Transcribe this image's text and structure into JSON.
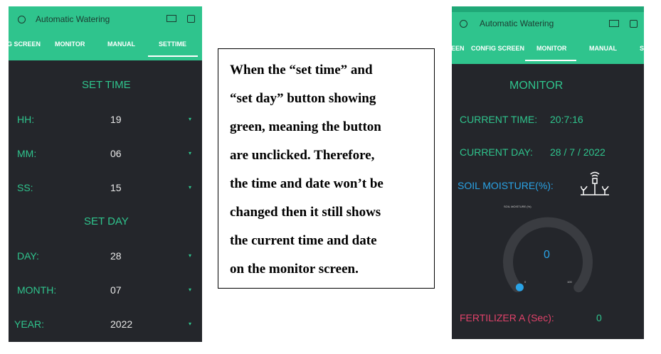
{
  "left_phone": {
    "app_title": "Automatic Watering",
    "tabs": [
      "G SCREEN",
      "MONITOR",
      "MANUAL",
      "SETTIME"
    ],
    "active_tab": "SETTIME",
    "set_time_heading": "SET TIME",
    "time_fields": [
      {
        "label": "HH:",
        "value": "19"
      },
      {
        "label": "MM:",
        "value": "06"
      },
      {
        "label": "SS:",
        "value": "15"
      }
    ],
    "set_day_heading": "SET DAY",
    "day_fields": [
      {
        "label": "DAY:",
        "value": "28"
      },
      {
        "label": "MONTH:",
        "value": "07"
      },
      {
        "label": "YEAR:",
        "value": "2022"
      }
    ],
    "dropdown_glyph": "▾"
  },
  "note": {
    "lines": [
      "When the “set time” and",
      "“set day” button showing",
      "green, meaning the button",
      "are unclicked. Therefore,",
      "the time and date won’t be",
      "changed then it still shows",
      "the current time and date",
      "on the monitor screen."
    ]
  },
  "right_phone": {
    "app_title": "Automatic Watering",
    "tabs": [
      "EEN",
      "CONFIG SCREEN",
      "MONITOR",
      "MANUAL",
      "S"
    ],
    "active_tab": "MONITOR",
    "heading": "MONITOR",
    "current_time_label": "CURRENT TIME:",
    "current_time_value": "20:7:16",
    "current_day_label": "CURRENT DAY:",
    "current_day_value": "28 / 7 / 2022",
    "soil_label": "SOIL MOISTURE(%):",
    "gauge_title": "SOIL MOISTURE (%)",
    "gauge_value": "0",
    "gauge_min": "0",
    "gauge_max": "100",
    "gauge_level": 0,
    "fertilizer_label": "FERTILIZER A (Sec):",
    "fertilizer_value": "0"
  },
  "colors": {
    "accent": "#2fc48d",
    "background": "#24262b",
    "gauge_track": "#3a3c41",
    "gauge_knob": "#2aa3e6",
    "fertilizer_label": "#e0426a"
  }
}
